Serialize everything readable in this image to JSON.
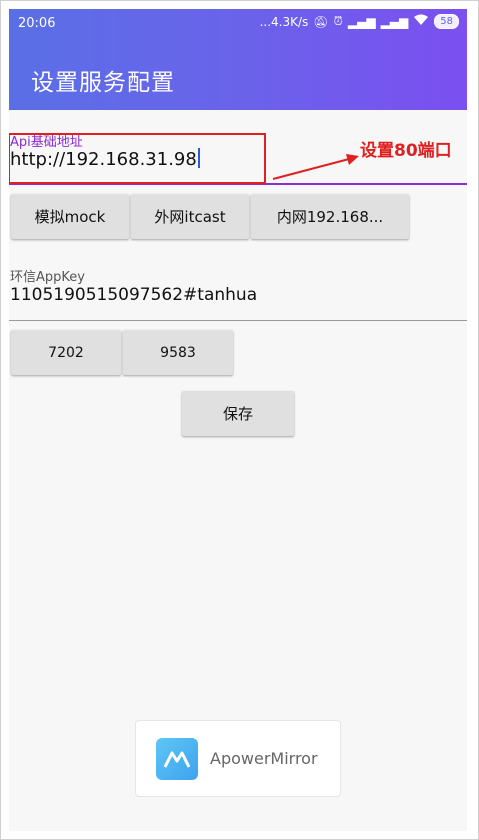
{
  "status": {
    "time": "20:06",
    "net_speed": "...4.3K/s",
    "signal": "▂▄▆",
    "battery": "58"
  },
  "appbar": {
    "title": "设置服务配置"
  },
  "api": {
    "label": "Api基础地址",
    "value": "http://192.168.31.98",
    "presets": [
      {
        "label": "模拟mock"
      },
      {
        "label": "外网itcast"
      },
      {
        "label": "内网192.168..."
      }
    ]
  },
  "annotation": {
    "text": "设置80端口"
  },
  "appkey": {
    "label": "环信AppKey",
    "value": "1105190515097562#tanhua",
    "presets": [
      {
        "label": "7202"
      },
      {
        "label": "9583"
      }
    ]
  },
  "save": {
    "label": "保存"
  },
  "watermark": {
    "text": "ApowerMirror"
  },
  "colors": {
    "accent": "#8a2bd4",
    "annotation": "#e02020",
    "appbar_start": "#5a6fe6",
    "appbar_end": "#7b4ff0"
  }
}
